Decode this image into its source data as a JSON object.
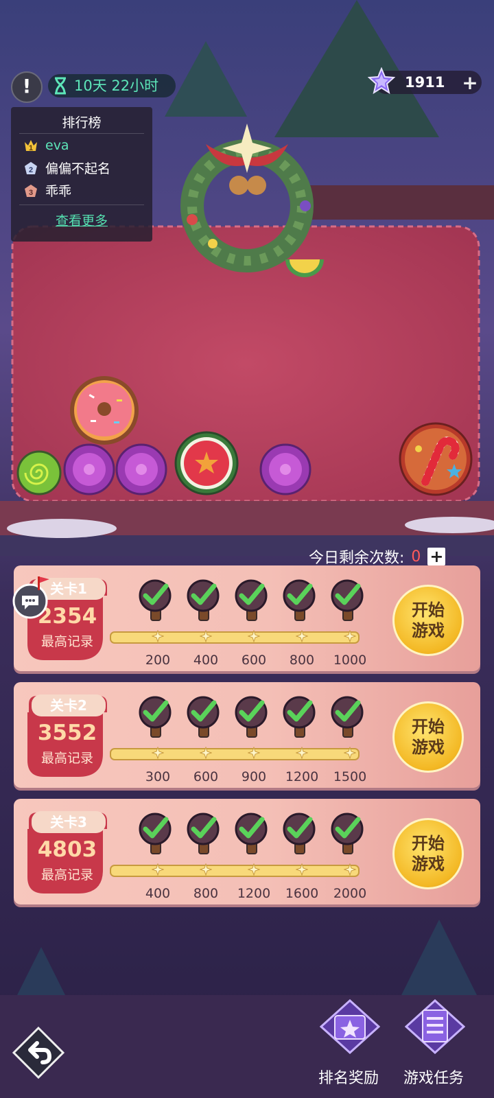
{
  "hud": {
    "alert_symbol": "!",
    "timer_text": "10天 22小时",
    "gems": "1911",
    "gem_plus": "+"
  },
  "leaderboard": {
    "title": "排行榜",
    "entries": [
      {
        "rank": "1",
        "name": "eva"
      },
      {
        "rank": "2",
        "name": "偏偏不起名"
      },
      {
        "rank": "3",
        "name": "乖乖"
      }
    ],
    "more": "查看更多"
  },
  "daily": {
    "label": "今日剩余次数:",
    "count": "0",
    "plus": "+"
  },
  "levels": [
    {
      "name": "关卡1",
      "score": "2354",
      "score_label": "最高记录",
      "milestones": [
        "200",
        "400",
        "600",
        "800",
        "1000"
      ],
      "start": "开始游戏"
    },
    {
      "name": "关卡2",
      "score": "3552",
      "score_label": "最高记录",
      "milestones": [
        "300",
        "600",
        "900",
        "1200",
        "1500"
      ],
      "start": "开始游戏"
    },
    {
      "name": "关卡3",
      "score": "4803",
      "score_label": "最高记录",
      "milestones": [
        "400",
        "800",
        "1200",
        "1600",
        "2000"
      ],
      "start": "开始游戏"
    }
  ],
  "bottom_nav": {
    "rank_reward": "排名奖励",
    "game_tasks": "游戏任务"
  },
  "colors": {
    "accent_green": "#5de6b9",
    "count_red": "#ff5a5a",
    "start_gold": "#f3b824",
    "card_pink": "#f7c7bd"
  }
}
